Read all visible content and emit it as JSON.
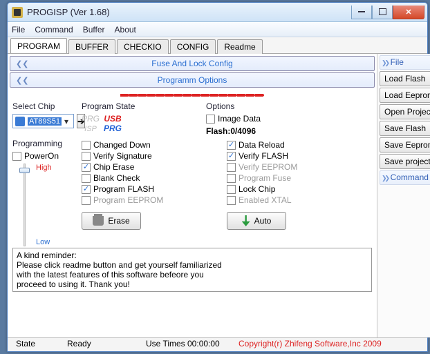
{
  "window": {
    "title": "PROGISP (Ver 1.68)"
  },
  "menu": {
    "file": "File",
    "command": "Command",
    "buffer": "Buffer",
    "about": "About"
  },
  "tabs": {
    "program": "PROGRAM",
    "buffer": "BUFFER",
    "checkio": "CHECKIO",
    "config": "CONFIG",
    "readme": "Readme"
  },
  "bands": {
    "fuse": "Fuse And Lock Config",
    "opts": "Programm Options"
  },
  "redline": "................................",
  "labels": {
    "selectChip": "Select Chip",
    "programState": "Program State",
    "options": "Options",
    "programming": "Programming"
  },
  "chip": {
    "selected": "AT89S51"
  },
  "state": {
    "top": "PRG",
    "mid": "ISP",
    "usb": "USB",
    "prg": "PRG"
  },
  "options": {
    "imageData": "Image Data",
    "flash": "Flash:0/4096"
  },
  "prog": {
    "powerOn": "PowerOn",
    "high": "High",
    "low": "Low"
  },
  "left": {
    "changedDown": "Changed Down",
    "verifySig": "Verify Signature",
    "chipErase": "Chip Erase",
    "blankCheck": "Blank Check",
    "programFlash": "Program FLASH",
    "programEeprom": "Program EEPROM"
  },
  "right": {
    "dataReload": "Data Reload",
    "verifyFlash": "Verify FLASH",
    "verifyEeprom": "Verify EEPROM",
    "programFuse": "Program Fuse",
    "lockChip": "Lock Chip",
    "enabledXtal": "Enabled XTAL"
  },
  "buttons": {
    "erase": "Erase",
    "auto": "Auto"
  },
  "reminder": "A kind reminder:\nPlease click readme button and get yourself familiarized\nwith the latest features of this software befeore you\nproceed to using it. Thank you!",
  "status": {
    "state": "State",
    "ready": "Ready",
    "useTimes": "Use Times    00:00:00",
    "copyright": "Copyright(r) Zhifeng Software,Inc 2009"
  },
  "side": {
    "fileHead": "File",
    "loadFlash": "Load Flash",
    "loadEeprom": "Load Eeprom",
    "openProject": "Open Project",
    "saveFlash": "Save Flash",
    "saveEeprom": "Save Eeprom",
    "saveProject": "Save project",
    "commandHead": "Command"
  }
}
